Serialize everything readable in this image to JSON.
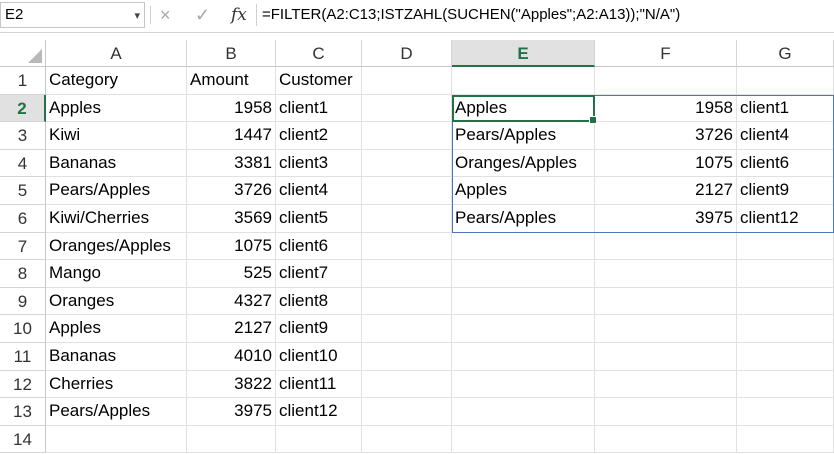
{
  "formula_bar": {
    "name_box": "E2",
    "cancel_icon": "×",
    "enter_icon": "✓",
    "fx_label": "fx",
    "formula": "=FILTER(A2:C13;ISTZAHL(SUCHEN(\"Apples\";A2:A13));\"N/A\")"
  },
  "columns": [
    "A",
    "B",
    "C",
    "D",
    "E",
    "F",
    "G"
  ],
  "selected_column": "E",
  "rows": [
    "1",
    "2",
    "3",
    "4",
    "5",
    "6",
    "7",
    "8",
    "9",
    "10",
    "11",
    "12",
    "13",
    "14"
  ],
  "selected_row": "2",
  "source_table": {
    "headers": [
      "Category",
      "Amount",
      "Customer"
    ],
    "rows": [
      [
        "Apples",
        "1958",
        "client1"
      ],
      [
        "Kiwi",
        "1447",
        "client2"
      ],
      [
        "Bananas",
        "3381",
        "client3"
      ],
      [
        "Pears/Apples",
        "3726",
        "client4"
      ],
      [
        "Kiwi/Cherries",
        "3569",
        "client5"
      ],
      [
        "Oranges/Apples",
        "1075",
        "client6"
      ],
      [
        "Mango",
        "525",
        "client7"
      ],
      [
        "Oranges",
        "4327",
        "client8"
      ],
      [
        "Apples",
        "2127",
        "client9"
      ],
      [
        "Bananas",
        "4010",
        "client10"
      ],
      [
        "Cherries",
        "3822",
        "client11"
      ],
      [
        "Pears/Apples",
        "3975",
        "client12"
      ]
    ]
  },
  "filter_result": {
    "rows": [
      [
        "Apples",
        "1958",
        "client1"
      ],
      [
        "Pears/Apples",
        "3726",
        "client4"
      ],
      [
        "Oranges/Apples",
        "1075",
        "client6"
      ],
      [
        "Apples",
        "2127",
        "client9"
      ],
      [
        "Pears/Apples",
        "3975",
        "client12"
      ]
    ]
  },
  "colors": {
    "accent": "#217346",
    "spill_border": "#4a78c0"
  }
}
